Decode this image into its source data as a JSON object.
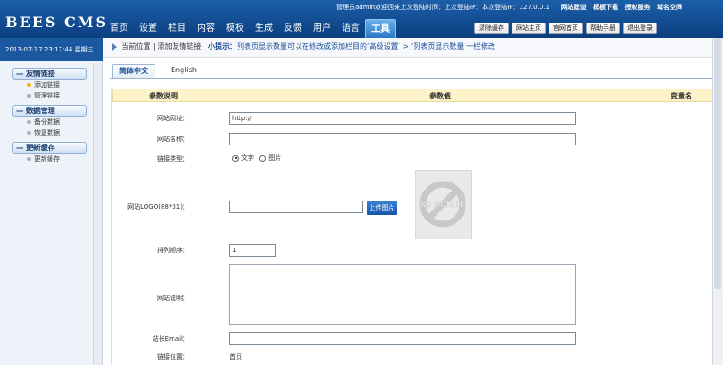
{
  "header": {
    "logo": "BEES CMS",
    "info": "管理员admin欢迎回来上次登陆时间：上次登陆IP：本次登陆IP：127.0.0.1",
    "links": [
      "网站建设",
      "模板下载",
      "授权服务",
      "域名空间"
    ]
  },
  "nav": [
    "首页",
    "设置",
    "栏目",
    "内容",
    "模板",
    "生成",
    "反馈",
    "用户",
    "语言",
    "工具"
  ],
  "top_buttons": [
    "清除缓存",
    "网站主页",
    "官网首页",
    "帮助手册",
    "退出登录"
  ],
  "datetime": "2013-07-17 23:17:44 星期三",
  "sidebar": [
    {
      "title": "友情链接",
      "items": [
        "添加链接",
        "管理链接"
      ]
    },
    {
      "title": "数据管理",
      "items": [
        "备份数据",
        "恢复数据"
      ]
    },
    {
      "title": "更新缓存",
      "items": [
        "更新缓存"
      ]
    }
  ],
  "breadcrumb": {
    "current": "当前位置",
    "sep": "|",
    "page": "添加友情链接",
    "tip_label": "小提示：",
    "tip": "列表页显示数量可以在修改或添加栏目的‘高级设置’ > ‘列表页显示数量’一栏修改"
  },
  "tabs": [
    "简体中文",
    "English"
  ],
  "table": {
    "headers": [
      "参数说明",
      "参数值",
      "变量名"
    ]
  },
  "form": {
    "url_label": "网站网址：",
    "url_value": "http://",
    "name_label": "网站名称：",
    "type_label": "链接类型：",
    "type_opt1": "文字",
    "type_opt2": "图片",
    "logo_label": "网站LOGO(88*31)：",
    "upload": "上传图片",
    "nopic": "NO PICTURE",
    "order_label": "排列顺序：",
    "order_value": "1",
    "desc_label": "网站说明：",
    "email_label": "站长Email：",
    "pos_label": "链接位置：",
    "pos_value": "首页"
  },
  "colors": {
    "header": "#1c5fa9",
    "accent": "#1756a8",
    "table_head": "#fdf3c8"
  }
}
